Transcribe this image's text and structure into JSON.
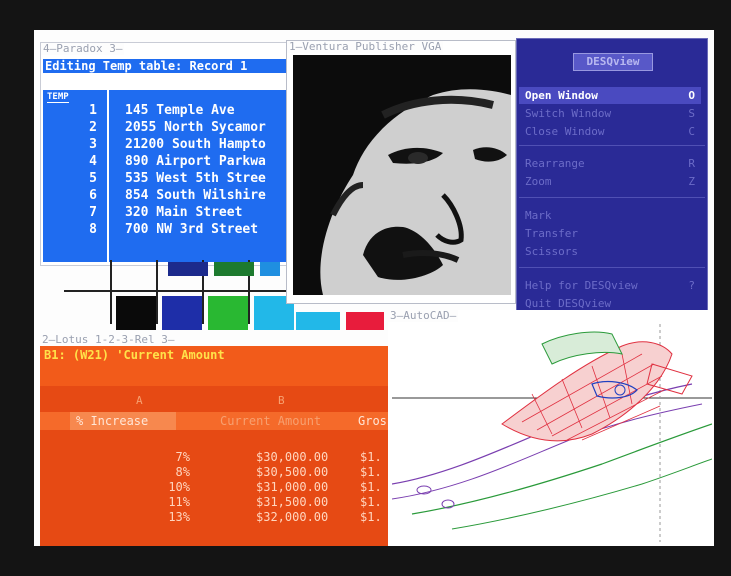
{
  "paradox": {
    "title": "4—Paradox 3—",
    "status": "Editing Temp table: Record 1",
    "table_name": "TEMP",
    "rows": [
      {
        "num": "1",
        "address": "145 Temple Ave"
      },
      {
        "num": "2",
        "address": "2055 North Sycamor"
      },
      {
        "num": "3",
        "address": "21200 South Hampto"
      },
      {
        "num": "4",
        "address": "890 Airport Parkwa"
      },
      {
        "num": "5",
        "address": "535 West 5th Stree"
      },
      {
        "num": "6",
        "address": "854 South Wilshire"
      },
      {
        "num": "7",
        "address": "320 Main Street"
      },
      {
        "num": "8",
        "address": "700 NW 3rd Street"
      }
    ]
  },
  "ventura": {
    "title": "1—Ventura Publisher VGA"
  },
  "desqview": {
    "title": "DESQview",
    "groups": [
      [
        {
          "label": "Open Window",
          "key": "O",
          "selected": true
        },
        {
          "label": "Switch Window",
          "key": "S",
          "selected": false
        },
        {
          "label": "Close Window",
          "key": "C",
          "selected": false
        }
      ],
      [
        {
          "label": "Rearrange",
          "key": "R",
          "selected": false
        },
        {
          "label": "Zoom",
          "key": "Z",
          "selected": false
        }
      ],
      [
        {
          "label": "Mark",
          "key": "",
          "selected": false
        },
        {
          "label": "Transfer",
          "key": "",
          "selected": false
        },
        {
          "label": "Scissors",
          "key": "",
          "selected": false
        }
      ],
      [
        {
          "label": "Help for DESQview",
          "key": "?",
          "selected": false
        },
        {
          "label": "Quit DESQview",
          "key": "",
          "selected": false
        }
      ]
    ]
  },
  "lotus": {
    "title": "2—Lotus 1-2-3-Rel 3—",
    "cell_entry": "B1: (W21) 'Current Amount",
    "col_letters": [
      "A",
      "B"
    ],
    "headers": {
      "increase": "% Increase",
      "current": "Current Amount",
      "gross": "Gros"
    },
    "rows": [
      {
        "pct": "7%",
        "amount": "$30,000.00",
        "gross": "$1."
      },
      {
        "pct": "8%",
        "amount": "$30,500.00",
        "gross": "$1."
      },
      {
        "pct": "10%",
        "amount": "$31,000.00",
        "gross": "$1."
      },
      {
        "pct": "11%",
        "amount": "$31,500.00",
        "gross": "$1."
      },
      {
        "pct": "13%",
        "amount": "$32,000.00",
        "gross": "$1."
      }
    ]
  },
  "autocad": {
    "title": "3—AutoCAD—"
  },
  "colors": {
    "paradox_blue": "#1f6cf0",
    "desqview_blue": "#2a2a96",
    "lotus_orange": "#f25b1a",
    "lotus_yellow": "#ffe24a"
  }
}
